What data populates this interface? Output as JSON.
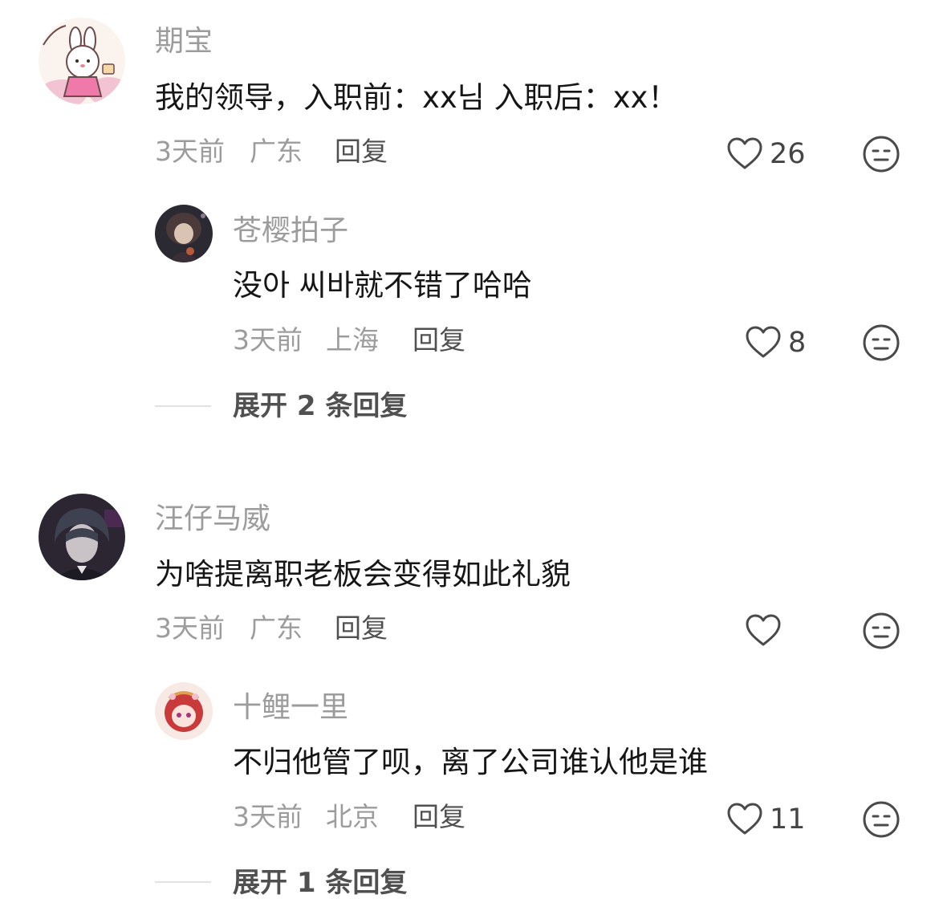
{
  "comments": [
    {
      "user": "期宝",
      "text": "我的领导，入职前：xx님 入职后：xx！",
      "time": "3天前",
      "location": "广东",
      "reply_label": "回复",
      "likes": "26",
      "replies": [
        {
          "user": "苍樱拍子",
          "text": "没아 씨바就不错了哈哈",
          "time": "3天前",
          "location": "上海",
          "reply_label": "回复",
          "likes": "8"
        }
      ],
      "expand_label": "展开 2 条回复"
    },
    {
      "user": "汪仔马威",
      "text": "为啥提离职老板会变得如此礼貌",
      "time": "3天前",
      "location": "广东",
      "reply_label": "回复",
      "likes": "",
      "replies": [
        {
          "user": "十鲤一里",
          "text": "不归他管了呗，离了公司谁认他是谁",
          "time": "3天前",
          "location": "北京",
          "reply_label": "回复",
          "likes": "11"
        }
      ],
      "expand_label": "展开 1 条回复"
    }
  ],
  "icons": {
    "like": "heart-outline-icon",
    "dislike": "neutral-face-icon"
  },
  "colors": {
    "username": "#9c9c9c",
    "text": "#161616",
    "meta": "#9c9c9c",
    "action": "#505050"
  }
}
